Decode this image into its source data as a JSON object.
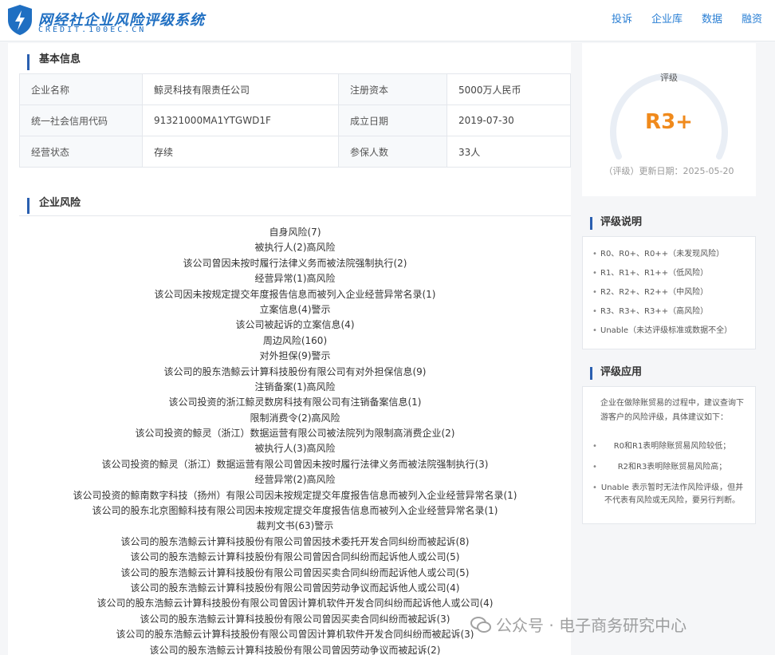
{
  "header": {
    "logo_main": "网经社企业风险评级系统",
    "logo_sub": "CREDIT.100EC.CN",
    "nav": [
      "投诉",
      "企业库",
      "数据",
      "融资"
    ]
  },
  "basic": {
    "title": "基本信息",
    "rows": [
      [
        "企业名称",
        "鲸灵科技有限责任公司",
        "注册资本",
        "5000万人民币"
      ],
      [
        "统一社会信用代码",
        "91321000MA1YTGWD1F",
        "成立日期",
        "2019-07-30"
      ],
      [
        "经营状态",
        "存续",
        "参保人数",
        "33人"
      ]
    ]
  },
  "rating": {
    "label": "评级",
    "value": "R3+",
    "date_text": "（评级）更新日期：2025-05-20",
    "value_color": "#f08a1c"
  },
  "risk": {
    "title": "企业风险",
    "items": [
      "自身风险(7)",
      "被执行人(2)高风险",
      "该公司曾因未按时履行法律义务而被法院强制执行(2)",
      "经营异常(1)高风险",
      "该公司因未按规定提交年度报告信息而被列入企业经营异常名录(1)",
      "立案信息(4)警示",
      "该公司被起诉的立案信息(4)",
      "周边风险(160)",
      "对外担保(9)警示",
      "该公司的股东浩鲸云计算科技股份有限公司有对外担保信息(9)",
      "注销备案(1)高风险",
      "该公司投资的浙江鲸灵数房科技有限公司有注销备案信息(1)",
      "限制消费令(2)高风险",
      "该公司投资的鲸灵（浙江）数据运营有限公司被法院列为限制高消费企业(2)",
      "被执行人(3)高风险",
      "该公司投资的鲸灵（浙江）数据运营有限公司曾因未按时履行法律义务而被法院强制执行(3)",
      "经营异常(2)高风险",
      "该公司投资的鲸南数字科技（扬州）有限公司因未按规定提交年度报告信息而被列入企业经营异常名录(1)",
      "该公司的股东北京图鲸科技有限公司因未按规定提交年度报告信息而被列入企业经营异常名录(1)",
      "裁判文书(63)警示",
      "该公司的股东浩鲸云计算科技股份有限公司曾因技术委托开发合同纠纷而被起诉(8)",
      "该公司的股东浩鲸云计算科技股份有限公司曾因合同纠纷而起诉他人或公司(5)",
      "该公司的股东浩鲸云计算科技股份有限公司曾因买卖合同纠纷而起诉他人或公司(5)",
      "该公司的股东浩鲸云计算科技股份有限公司曾因劳动争议而起诉他人或公司(4)",
      "该公司的股东浩鲸云计算科技股份有限公司曾因计算机软件开发合同纠纷而起诉他人或公司(4)",
      "该公司的股东浩鲸云计算科技股份有限公司曾因买卖合同纠纷而被起诉(3)",
      "该公司的股东浩鲸云计算科技股份有限公司曾因计算机软件开发合同纠纷而被起诉(3)",
      "该公司的股东浩鲸云计算科技股份有限公司曾因劳动争议而被起诉(2)"
    ]
  },
  "explain": {
    "title": "评级说明",
    "items": [
      "R0、R0+、R0++（未发现风险）",
      "R1、R1+、R1++（低风险）",
      "R2、R2+、R2++（中风险）",
      "R3、R3+、R3++（高风险）",
      "Unable（未达评级标准或数据不全）"
    ]
  },
  "application": {
    "title": "评级应用",
    "intro": "企业在做除账贸易的过程中，建议查询下游客户的风险评级，具体建议如下：",
    "items": [
      "R0和R1表明除账贸易风险较低；",
      "R2和R3表明除账贸易风险高；",
      "Unable 表示暂时无法作风险评级，但并不代表有风险或无风险，要另行判断。"
    ]
  },
  "watermark": "公众号 · 电子商务研究中心"
}
